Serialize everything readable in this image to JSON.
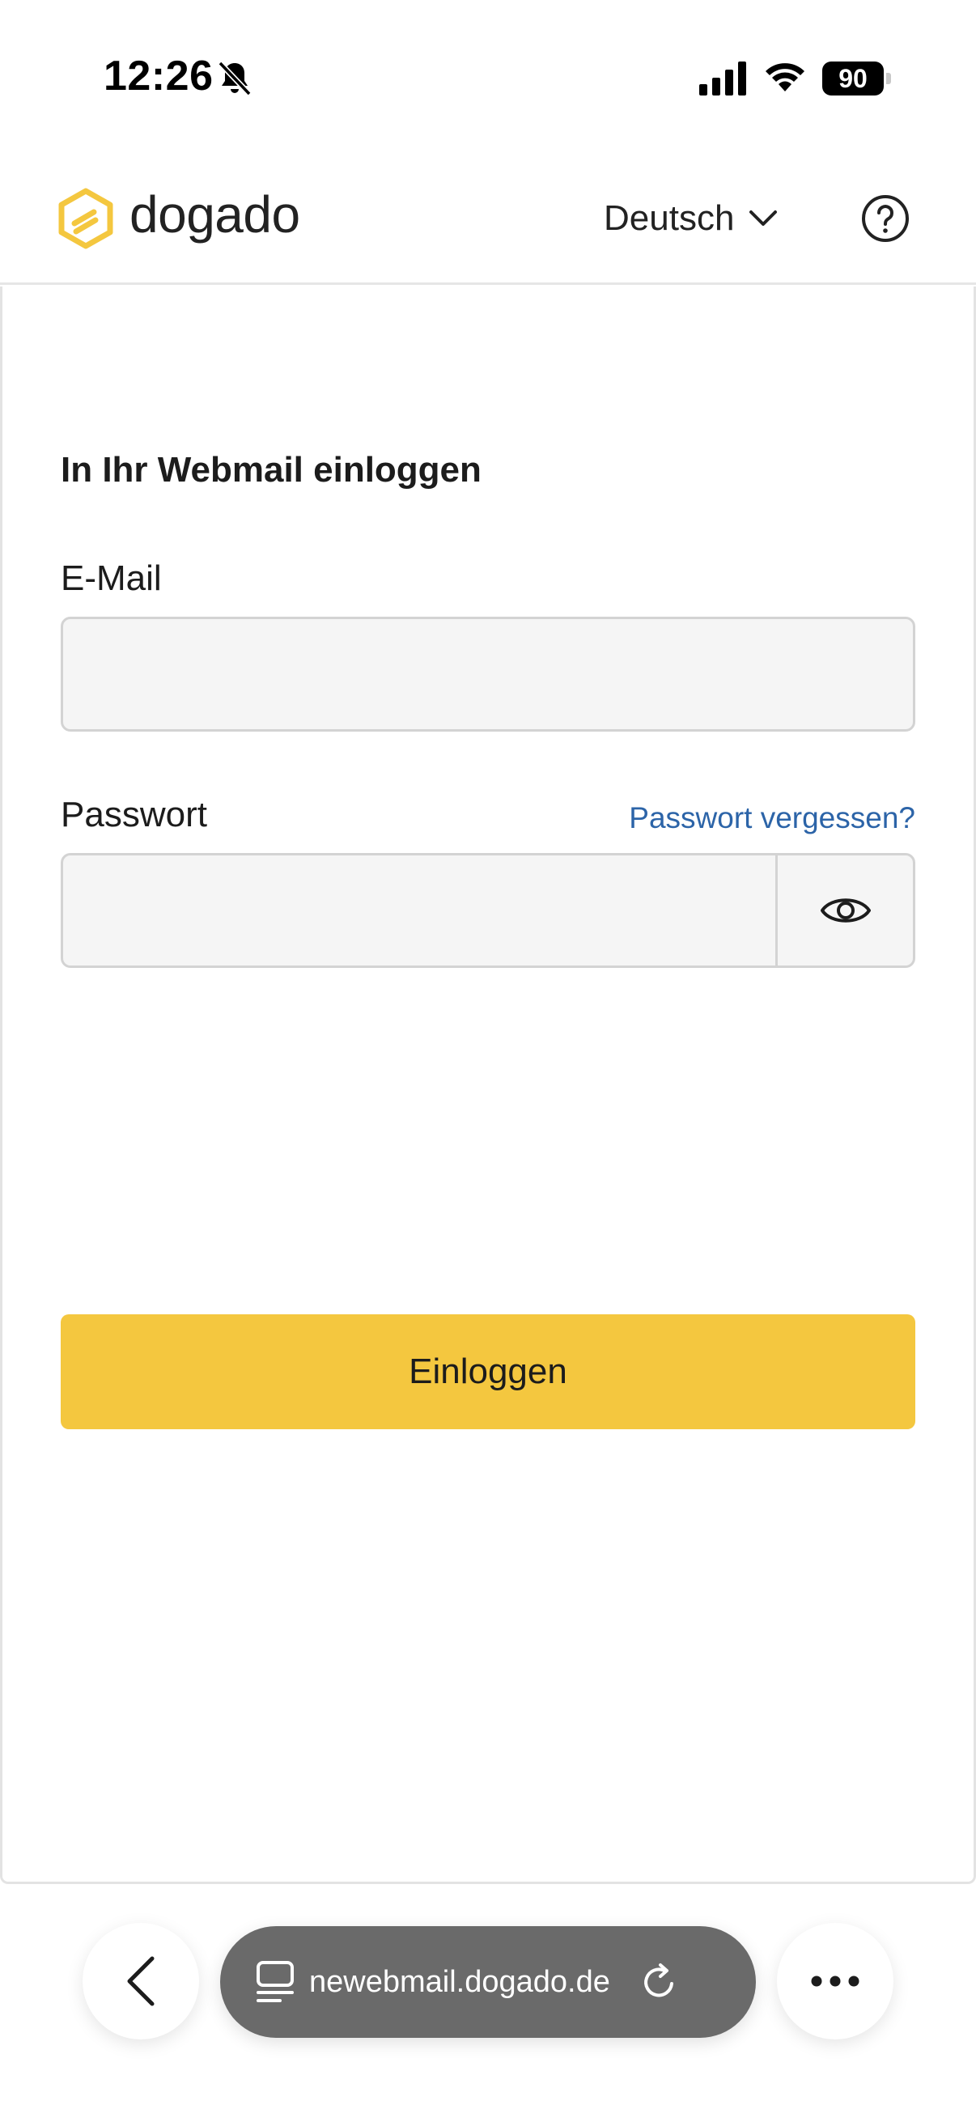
{
  "status_bar": {
    "time": "12:26",
    "battery_level": "90"
  },
  "header": {
    "brand": "dogado",
    "language": "Deutsch",
    "brand_color": "#f4c73f"
  },
  "login": {
    "title": "In Ihr Webmail einloggen",
    "email_label": "E-Mail",
    "email_value": "",
    "password_label": "Passwort",
    "forgot_password": "Passwort vergessen?",
    "password_value": "",
    "submit_label": "Einloggen",
    "link_color": "#2c64a8"
  },
  "browser": {
    "url": "newebmail.dogado.de"
  },
  "icons": [
    "bell-slash-icon",
    "cellular-signal-icon",
    "wifi-icon",
    "battery-icon",
    "dogado-logo-icon",
    "chevron-down-icon",
    "help-icon",
    "eye-icon",
    "back-arrow-icon",
    "tabs-icon",
    "reload-icon",
    "more-icon"
  ]
}
